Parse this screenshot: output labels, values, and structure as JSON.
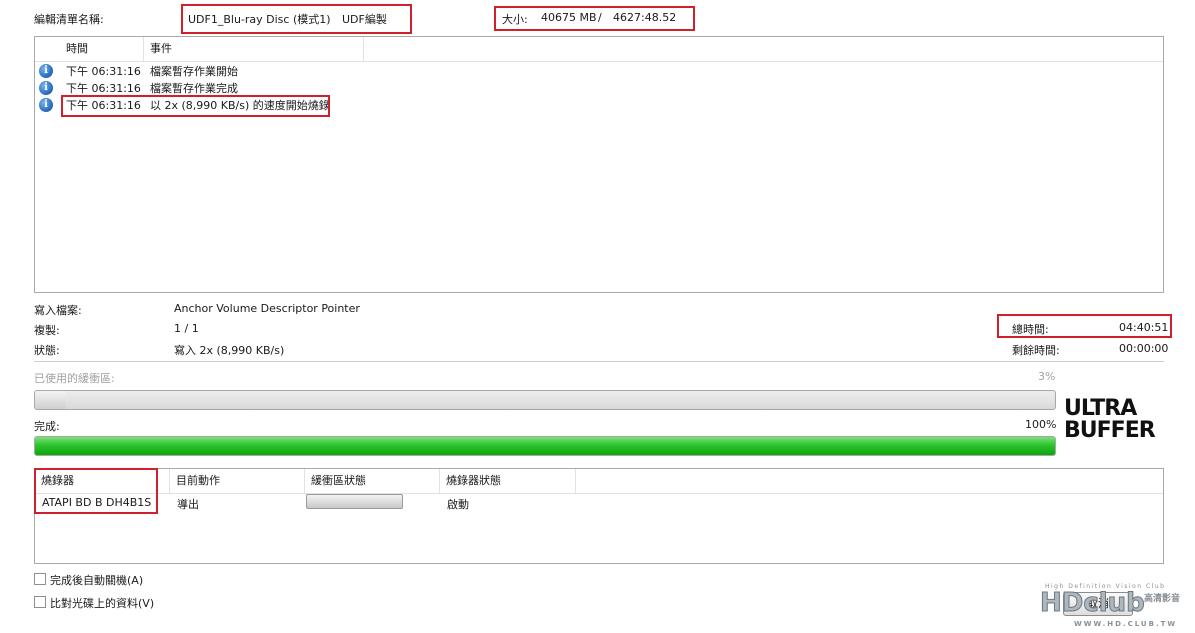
{
  "header": {
    "compilation_label": "編輯清單名稱:",
    "disc_name": "UDF1_Blu-ray Disc (模式1)",
    "disc_format": "UDF編製",
    "size_label": "大小:",
    "size_mb": "40675 MB",
    "size_sep": "/",
    "size_time": "4627:48.52"
  },
  "log": {
    "columns": [
      "時間",
      "事件"
    ],
    "rows": [
      {
        "time": "下午 06:31:16",
        "event": "檔案暫存作業開始",
        "icon": "info-icon"
      },
      {
        "time": "下午 06:31:16",
        "event": "檔案暫存作業完成",
        "icon": "info-icon"
      },
      {
        "time": "下午 06:31:16",
        "event": "以 2x (8,990 KB/s) 的速度開始燒錄",
        "icon": "info-icon"
      }
    ]
  },
  "status": {
    "writing_file_label": "寫入檔案:",
    "writing_file_value": "Anchor Volume Descriptor Pointer",
    "copy_label": "複製:",
    "copy_value": "1 / 1",
    "state_label": "狀態:",
    "state_value": "寫入 2x (8,990 KB/s)",
    "total_time_label": "總時間:",
    "total_time_value": "04:40:51",
    "remaining_label": "剩餘時間:",
    "remaining_value": "00:00:00"
  },
  "buffer": {
    "label": "已使用的緩衝區:",
    "percent_text": "3%",
    "fraction": 0.03
  },
  "complete": {
    "label": "完成:",
    "percent_text": "100%",
    "fraction": 1.0
  },
  "logo": {
    "line1": "ULTRA",
    "line2": "BUFFER"
  },
  "recorders": {
    "columns": [
      "燒錄器",
      "目前動作",
      "緩衝區狀態",
      "燒錄器狀態"
    ],
    "rows": [
      {
        "name": "ATAPI BD  B  DH4B1S",
        "action": "導出",
        "state": "啟動"
      }
    ]
  },
  "options": {
    "shutdown_label": "完成後自動關機(A)",
    "verify_label": "比對光碟上的資料(V)"
  },
  "footer": {
    "button_label": "取消"
  },
  "watermark": {
    "tagline": "High Definition Vision Club",
    "brand": "HDclub",
    "cn": "高清影音",
    "url": "WWW.HD.CLUB.TW"
  },
  "colors": {
    "highlight": "#d0202a",
    "progress_green": "#1db51d"
  }
}
